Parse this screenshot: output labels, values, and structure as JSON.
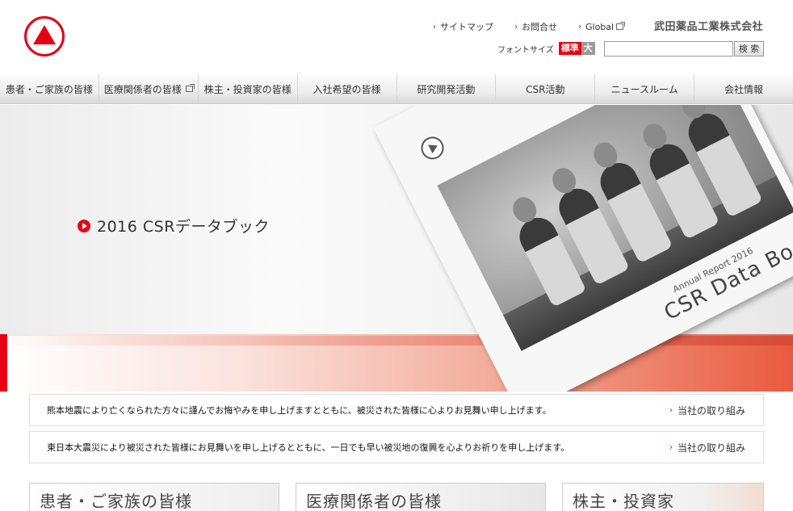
{
  "header": {
    "company_name": "武田薬品工業株式会社",
    "util_links": [
      {
        "label": "サイトマップ"
      },
      {
        "label": "お問合せ"
      },
      {
        "label": "Global"
      }
    ],
    "font_size": {
      "label": "フォントサイズ",
      "standard": "標準",
      "large": "大"
    },
    "search": {
      "placeholder": "",
      "button_label": "検 索"
    }
  },
  "nav": {
    "items": [
      {
        "label": "患者・ご家族の皆様"
      },
      {
        "label": "医療関係者の皆様"
      },
      {
        "label": "株主・投資家の皆様"
      },
      {
        "label": "入社希望の皆様"
      },
      {
        "label": "研究開発活動"
      },
      {
        "label": "CSR活動"
      },
      {
        "label": "ニュースルーム"
      },
      {
        "label": "会社情報"
      }
    ]
  },
  "hero": {
    "title": "2016 CSRデータブック",
    "book_annual": "Annual Report 2016",
    "book_title": "CSR Data Book"
  },
  "notices": [
    {
      "text": "熊本地震により亡くなられた方々に謹んでお悔やみを申し上げますとともに、被災された皆様に心よりお見舞い申し上げます。",
      "link": "当社の取り組み"
    },
    {
      "text": "東日本大震災により被災された皆様にお見舞いを申し上げるとともに、一日でも早い被災地の復興を心よりお祈りを申し上げます。",
      "link": "当社の取り組み"
    }
  ],
  "cards": [
    {
      "title": "患者・ご家族の皆様"
    },
    {
      "title": "医療関係者の皆様"
    },
    {
      "title": "株主・投資家"
    }
  ],
  "colors": {
    "brand_red": "#e60012",
    "nav_bg": "#ededed"
  }
}
